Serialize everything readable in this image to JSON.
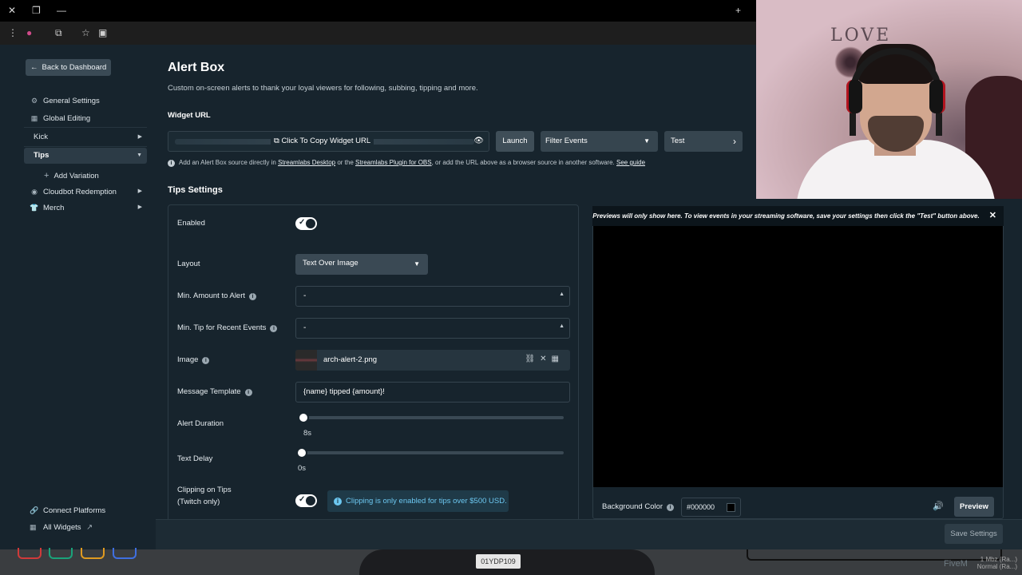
{
  "browser": {
    "icons": [
      "close-icon",
      "restore-icon",
      "minimize-icon",
      "new-tab-icon",
      "menu-icon",
      "extension-icon",
      "bookmark-icon",
      "cast-icon"
    ]
  },
  "sidebar": {
    "back_label": "Back to Dashboard",
    "items": [
      {
        "label": "General Settings",
        "icon": "gear-icon"
      },
      {
        "label": "Global Editing",
        "icon": "grid-icon"
      },
      {
        "label": "Kick",
        "icon": ""
      },
      {
        "label": "Tips",
        "icon": ""
      },
      {
        "label": "Add Variation",
        "icon": "plus-icon"
      },
      {
        "label": "Cloudbot Redemption",
        "icon": "cloudbot-icon"
      },
      {
        "label": "Merch",
        "icon": "shirt-icon"
      }
    ],
    "bottom": {
      "connect": "Connect Platforms",
      "all_widgets": "All Widgets"
    }
  },
  "main": {
    "title": "Alert Box",
    "subtitle": "Custom on-screen alerts to thank your loyal viewers for following, subbing, tipping and more.",
    "widget_url_label": "Widget URL",
    "copy_label": "Click To Copy Widget URL",
    "launch_label": "Launch",
    "filter_label": "Filter Events",
    "test_label": "Test",
    "info": {
      "part1": "Add an Alert Box source directly in ",
      "link1": "Streamlabs Desktop",
      "part2": " or the ",
      "link2": "Streamlabs Plugin for OBS",
      "part3": ", or add the URL above as a browser source in another software. ",
      "link3": "See guide"
    },
    "tips_settings_label": "Tips Settings"
  },
  "form": {
    "enabled_label": "Enabled",
    "layout_label": "Layout",
    "layout_value": "Text Over Image",
    "min_amount_label": "Min. Amount to Alert",
    "min_amount_value": "-",
    "min_tip_label": "Min. Tip for Recent Events",
    "min_tip_value": "-",
    "image_label": "Image",
    "image_value": "arch-alert-2.png",
    "message_label": "Message Template",
    "message_value": "{name} tipped {amount}!",
    "duration_label": "Alert Duration",
    "duration_value": "8s",
    "text_delay_label": "Text Delay",
    "text_delay_value": "0s",
    "clipping_label_1": "Clipping on Tips",
    "clipping_label_2": "(Twitch only)",
    "clipping_note": "Clipping is only enabled for tips over $500 USD."
  },
  "preview": {
    "banner": "Previews will only show here. To view events in your streaming software, save your settings then click the \"Test\" button above.",
    "bg_label": "Background Color",
    "bg_value": "#000000",
    "preview_label": "Preview"
  },
  "footer": {
    "save_label": "Save Settings"
  },
  "overlay": {
    "watermark": "FiveM",
    "plate": "01YDP109",
    "meta_1": "1 Mbz (Ra...)",
    "meta_2": "Normal (Ra...)",
    "wall_sign": "LOVE"
  },
  "colors": {
    "background": "#17242d",
    "accent_info": "#6cc7f0",
    "preview_bg": "#000000"
  }
}
